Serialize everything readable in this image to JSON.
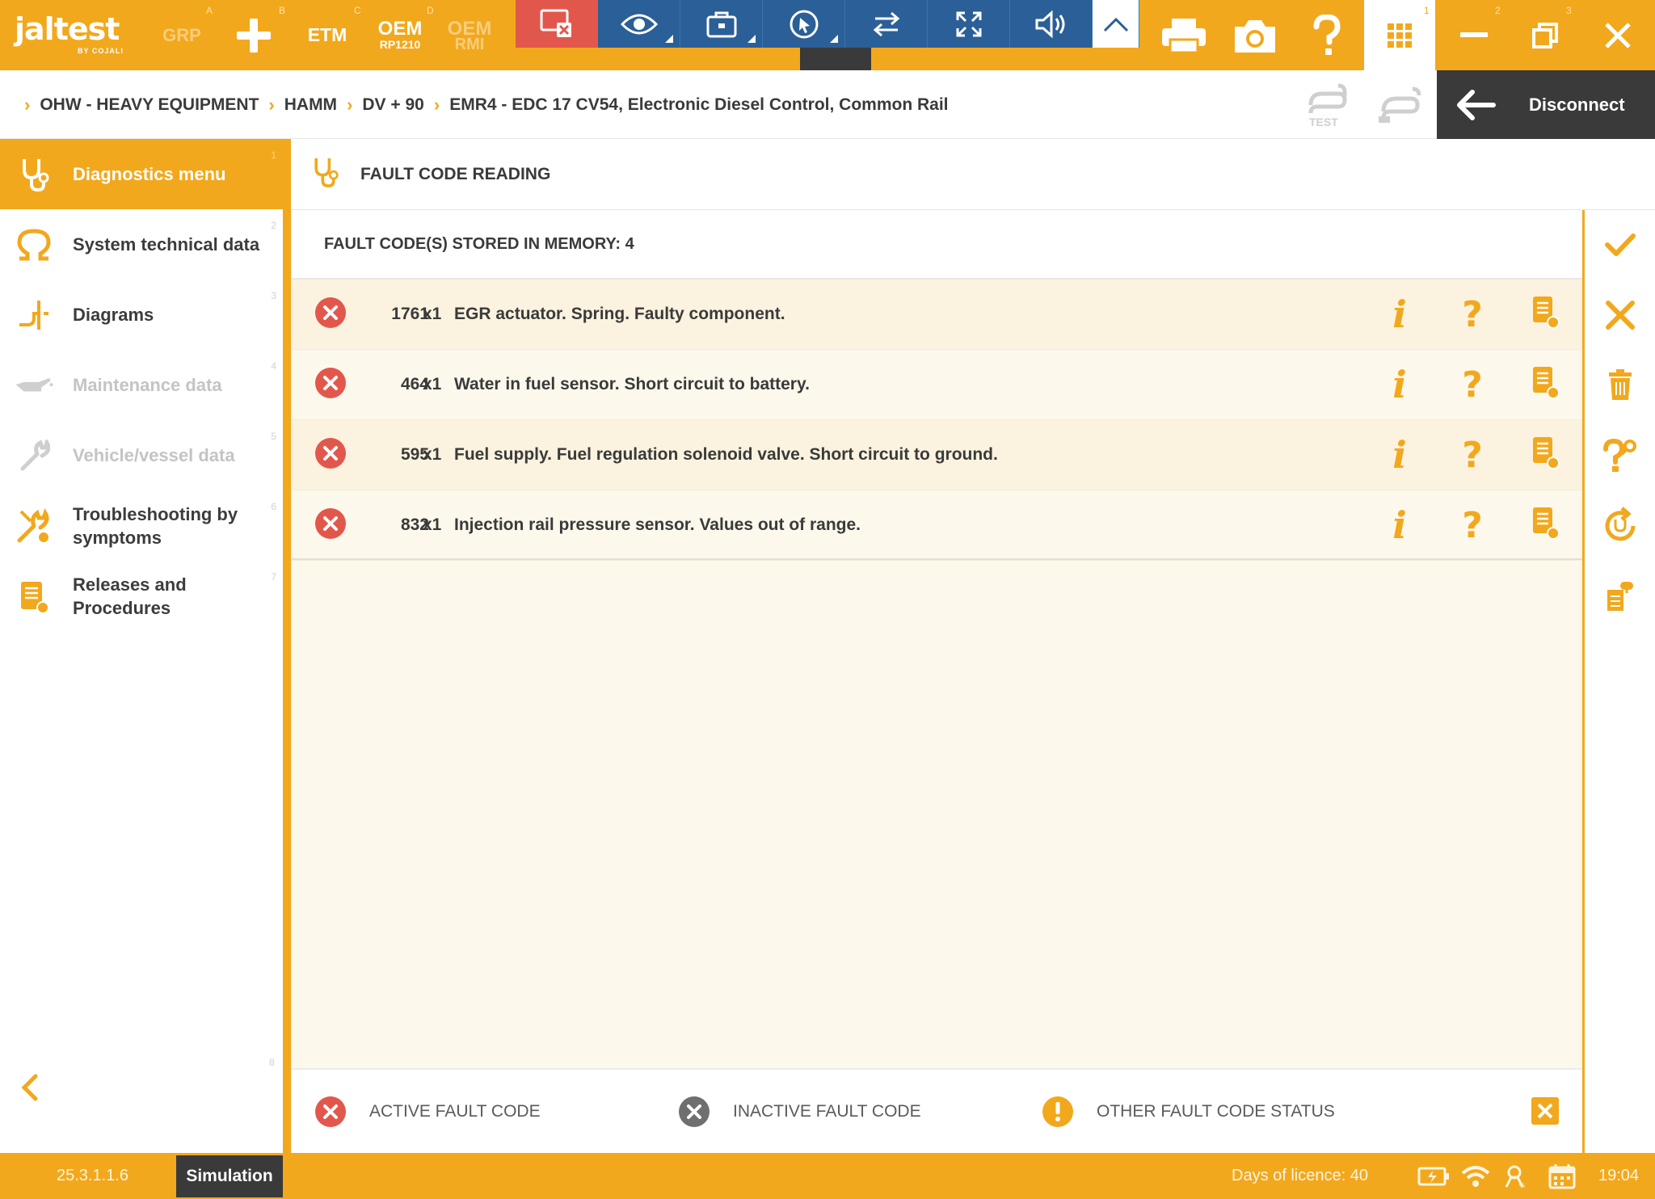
{
  "app": {
    "logo_text": "jaltest",
    "logo_sub": "BY COJALI"
  },
  "toolbar": {
    "grp_label": "GRP",
    "etm_label": "ETM",
    "oem_label": "OEM",
    "oem_sub": "RP1210",
    "oem_rmi_label": "OEM",
    "oem_rmi_sub": "RMI",
    "window_numbers": [
      "1",
      "2",
      "3"
    ],
    "icons": [
      "plus-icon",
      "printer-icon",
      "camera-icon",
      "help-icon",
      "apps-grid-icon",
      "minimize-icon",
      "restore-icon",
      "close-icon"
    ]
  },
  "remote_toolbar": {
    "icons": [
      "end-session-icon",
      "view-icon",
      "toolbox-icon",
      "pointer-icon",
      "transfer-icon",
      "fullscreen-icon",
      "sound-icon",
      "collapse-icon"
    ]
  },
  "breadcrumb": {
    "items": [
      "OHW - HEAVY EQUIPMENT",
      "HAMM",
      "DV + 90",
      "EMR4 - EDC 17 CV54, Electronic Diesel Control, Common Rail"
    ],
    "test_label": "TEST"
  },
  "disconnect": {
    "label": "Disconnect"
  },
  "sidebar": {
    "items": [
      {
        "label": "Diagnostics menu",
        "num": "1",
        "icon": "stethoscope-icon",
        "state": "active"
      },
      {
        "label": "System technical data",
        "num": "2",
        "icon": "ohm-icon",
        "state": "normal"
      },
      {
        "label": "Diagrams",
        "num": "3",
        "icon": "diagram-icon",
        "state": "normal"
      },
      {
        "label": "Maintenance data",
        "num": "4",
        "icon": "oil-can-icon",
        "state": "disabled"
      },
      {
        "label": "Vehicle/vessel data",
        "num": "5",
        "icon": "wrench-icon",
        "state": "disabled"
      },
      {
        "label": "Troubleshooting by symptoms",
        "num": "6",
        "icon": "troubleshoot-icon",
        "state": "normal"
      },
      {
        "label": "Releases and Procedures",
        "num": "7",
        "icon": "procedures-icon",
        "state": "normal"
      }
    ],
    "collapse_num": "8"
  },
  "main": {
    "title": "FAULT CODE READING",
    "count_label": "FAULT CODE(S) STORED IN MEMORY: 4",
    "faults": [
      {
        "code": "1761",
        "occurrences": "x1",
        "description": "EGR actuator. Spring. Faulty component.",
        "status": "active"
      },
      {
        "code": "464",
        "occurrences": "x1",
        "description": "Water in fuel sensor. Short circuit to battery.",
        "status": "active"
      },
      {
        "code": "595",
        "occurrences": "x1",
        "description": "Fuel supply. Fuel regulation solenoid valve. Short circuit to ground.",
        "status": "active"
      },
      {
        "code": "832",
        "occurrences": "x1",
        "description": "Injection rail pressure sensor. Values out of range.",
        "status": "active"
      }
    ],
    "row_actions": {
      "info": "i",
      "help": "?"
    }
  },
  "legend": {
    "active": "ACTIVE FAULT CODE",
    "inactive": "INACTIVE FAULT CODE",
    "other": "OTHER FAULT CODE STATUS"
  },
  "right_actions": [
    "confirm-icon",
    "cancel-icon",
    "delete-icon",
    "guided-help-icon",
    "refresh-diagnostics-icon",
    "report-icon"
  ],
  "statusbar": {
    "version": "25.3.1.1.6",
    "mode": "Simulation",
    "licence": "Days of licence: 40",
    "time": "19:04"
  },
  "colors": {
    "brand_orange": "#f2a81d",
    "remote_blue": "#2b5f97",
    "active_red": "#e2574c",
    "inactive_gray": "#6f6f6f",
    "other_yellow": "#f2a81d",
    "dark": "#3a3a3a"
  }
}
